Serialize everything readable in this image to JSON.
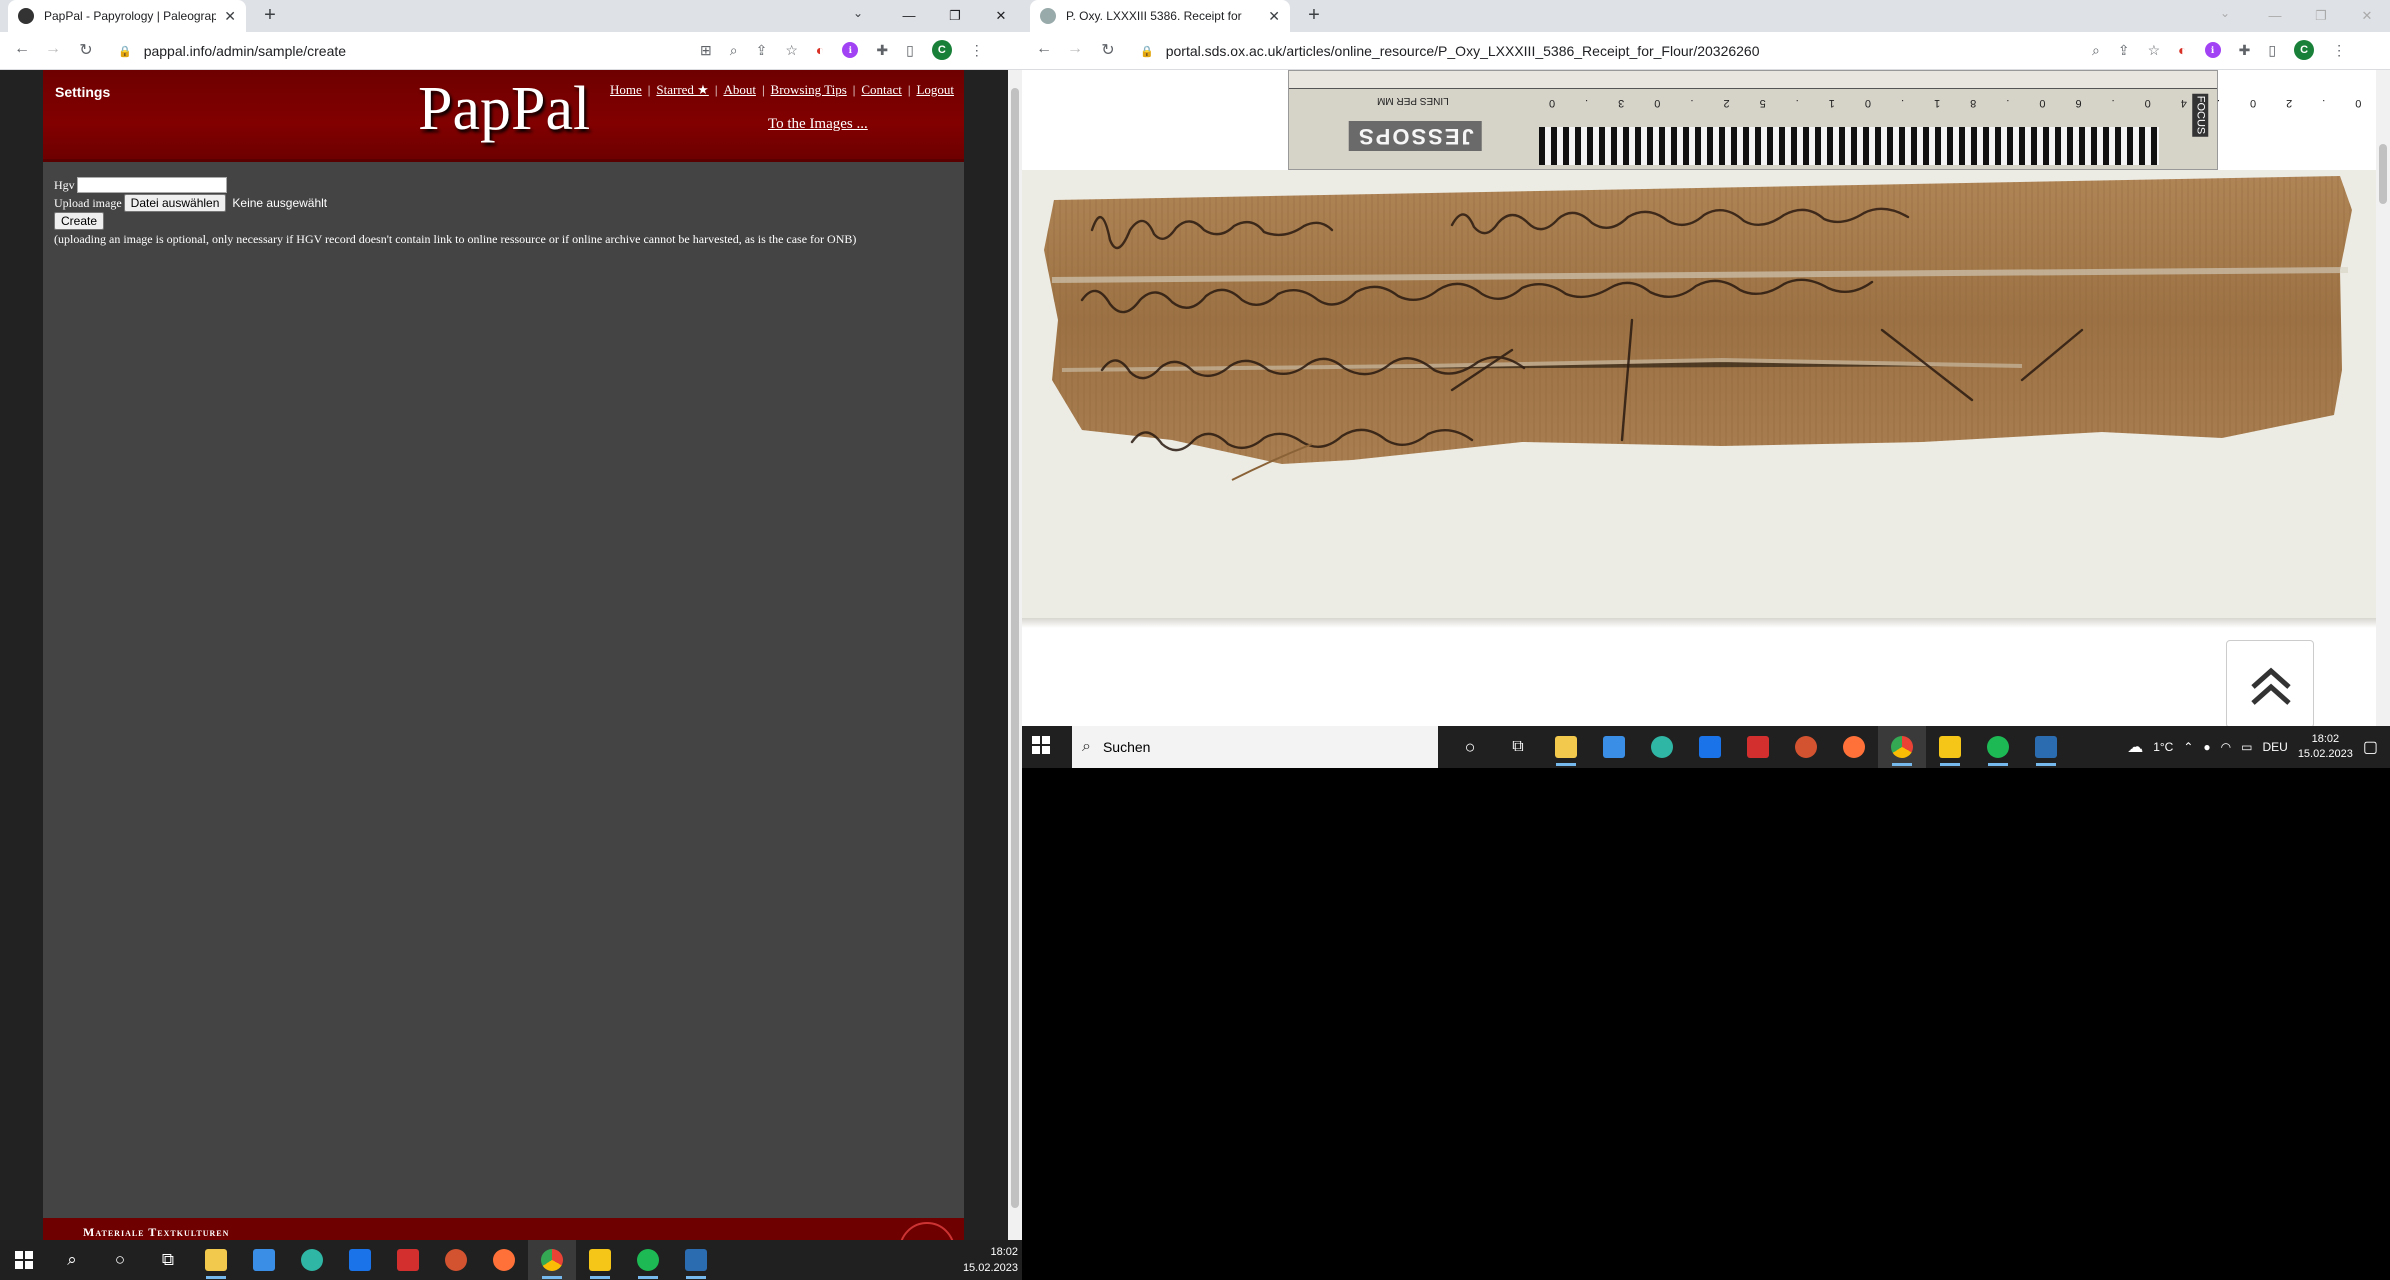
{
  "left_browser": {
    "tab_title": "PapPal - Papyrology | Paleograph",
    "url": "pappal.info/admin/sample/create"
  },
  "right_browser": {
    "tab_title": "P. Oxy. LXXXIII 5386. Receipt for",
    "url": "portal.sds.ox.ac.uk/articles/online_resource/P_Oxy_LXXXIII_5386_Receipt_for_Flour/20326260"
  },
  "pappal": {
    "settings": "Settings",
    "site_title": "PapPal",
    "nav": [
      "Home",
      "Starred ★",
      "About",
      "Browsing Tips",
      "Contact",
      "Logout"
    ],
    "images_link": "To the Images ...",
    "form": {
      "hgv_label": "Hgv",
      "upload_label": "Upload image",
      "file_button": "Datei auswählen",
      "file_status": "Keine ausgewählt",
      "create_button": "Create",
      "note": "(uploading an image is optional, only necessary if HGV record doesn't contain link to online ressource or if online archive cannot be harvested, as is the case for ONB)"
    },
    "footer_text": "Materiale Textkulturen"
  },
  "oxford": {
    "ruler_brand": "JESSOPS",
    "ruler_scale": [
      "0.2",
      "0.4",
      "0.6",
      "0.8",
      "1.0",
      "1.5",
      "2.0",
      "3.0"
    ],
    "ruler_label": "LINES PER MM",
    "ruler_focus": "FOCUS"
  },
  "inner_taskbar": {
    "search_placeholder": "Suchen",
    "weather": "1°C",
    "language": "DEU",
    "time": "18:02",
    "date": "15.02.2023"
  },
  "main_taskbar": {
    "time": "18:02",
    "date": "15.02.2023"
  },
  "colors": {
    "pappal_red": "#820000",
    "pappal_bg": "#444444",
    "taskbar": "#202020",
    "papyrus": "#a57c4d"
  }
}
